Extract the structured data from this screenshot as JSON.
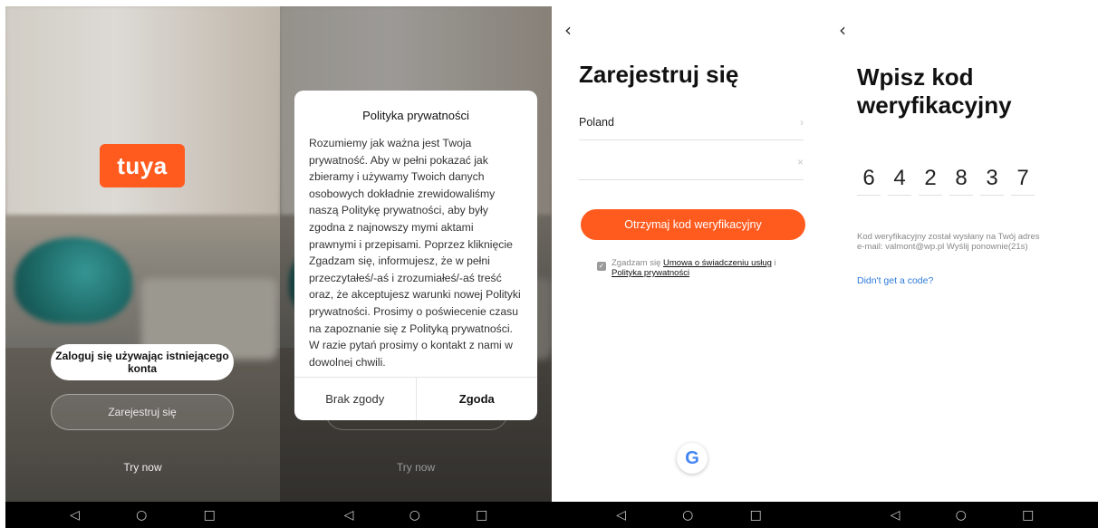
{
  "screen1": {
    "logo_text": "tuya",
    "login_label": "Zaloguj się używając istniejącego konta",
    "register_label": "Zarejestruj się",
    "try_now": "Try now"
  },
  "screen2": {
    "dialog_title": "Polityka prywatności",
    "dialog_text": "Rozumiemy jak ważna jest Twoja prywatność. Aby w pełni pokazać jak zbieramy i używamy Twoich danych osobowych dokładnie zrewidowaliśmy naszą Politykę prywatności, aby były zgodna z najnowszy mymi aktami prawnymi i przepisami. Poprzez kliknięcie Zgadzam się, informujesz, że w pełni przeczytałeś/-aś i zrozumiałeś/-aś treść oraz, że akceptujesz warunki nowej Polityki prywatności. Prosimy o poświecenie czasu na zapoznanie się z Polityką prywatności. W razie pytań prosimy o kontakt z nami w dowolnej chwili.",
    "decline_label": "Brak zgody",
    "agree_label": "Zgoda",
    "try_now": "Try now"
  },
  "screen3": {
    "back_icon": "‹",
    "title": "Zarejestruj się",
    "country_value": "Poland",
    "country_arrow": "›",
    "clear_icon": "×",
    "email_value": "",
    "button_label": "Otrzymaj kod weryfikacyjny",
    "agree_prefix": "Zgadzam się",
    "terms_link": "Umowa o świadczeniu usług",
    "agree_and": "i",
    "privacy_link": "Polityka prywatności",
    "google_letter": "G"
  },
  "screen4": {
    "back_icon": "‹",
    "title_line1": "Wpisz kod",
    "title_line2": "weryfikacyjny",
    "code": [
      "6",
      "4",
      "2",
      "8",
      "3",
      "7"
    ],
    "info_line1": "Kod weryfikacyjny został wysłany na Twój adres",
    "info_line2": "e-mail: valmont@wp.pl  Wyślij ponownie(21s)",
    "help_link": "Didn't get a code?"
  },
  "navbar": {
    "back": "◁",
    "home": "○",
    "recents": "□"
  },
  "colors": {
    "accent": "#ff5b1f",
    "link": "#2f7ad8"
  }
}
